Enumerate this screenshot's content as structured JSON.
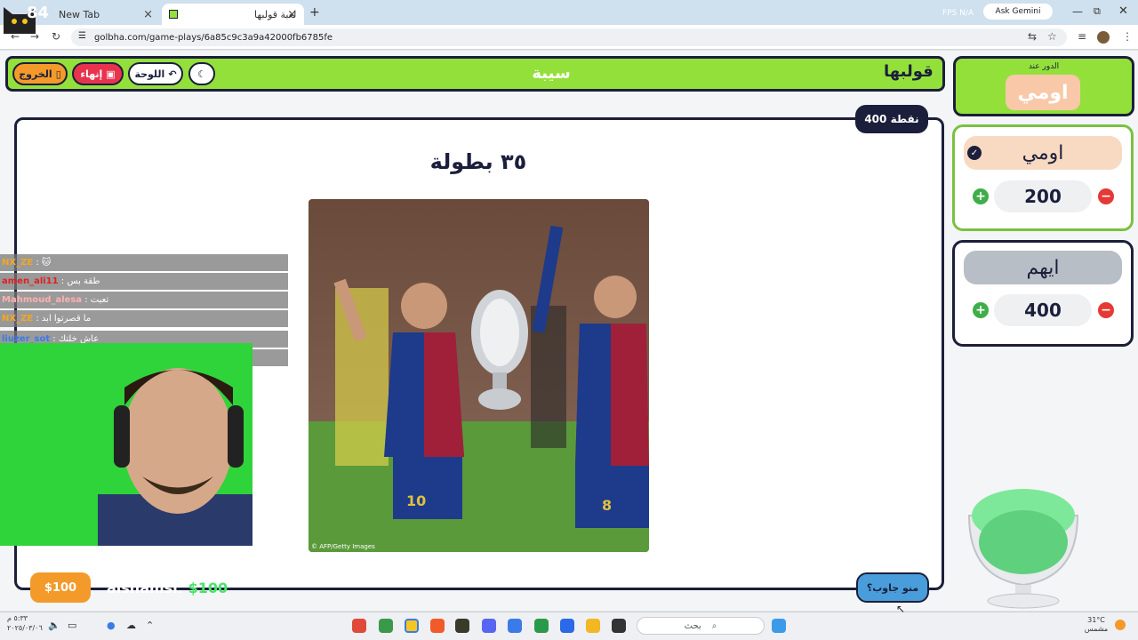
{
  "browser": {
    "tabs": [
      {
        "label": "New Tab"
      },
      {
        "label": "لعبة قولبها"
      }
    ],
    "url": "golbha.com/game-plays/6a85c9c3a9a42000fb6785fe",
    "ask_gemini": "Ask Gemini",
    "fps_readout": "FPS N/A"
  },
  "game": {
    "logo": "قولبها",
    "category": "سيبة",
    "buttons": {
      "exit": "الخروج",
      "end": "إنهاء",
      "board": "اللوحة"
    },
    "points_badge": "400 نقطة",
    "question": "٣٥ بطولة",
    "photo_credit": "© AFP/Getty Images",
    "who_answered": "منو جاوب؟"
  },
  "sidebar": {
    "turn_label": "الدور عند",
    "turn_team": "اومي",
    "teams": [
      {
        "name": "اومي",
        "score": "200"
      },
      {
        "name": "ايهم",
        "score": "400"
      }
    ]
  },
  "stream": {
    "viewer_count": "84",
    "chat": [
      {
        "user": "NX_ZE",
        "message": "🐱"
      },
      {
        "user": "amen_ali11",
        "message": "طقة بس"
      },
      {
        "user": "Mahmoud_alesa",
        "message": "تعبت"
      },
      {
        "user": "NX_ZE",
        "message": "ما قصرتوا ابد"
      },
      {
        "user": "liuzer_sot",
        "message": "عاش خلتك"
      }
    ],
    "donor_name": "alshamsi:",
    "donor_amount": "$100",
    "donor_pill": "$100"
  },
  "taskbar": {
    "search_placeholder": "بحث",
    "time": "٥:٣٣ م",
    "date": "٢٠٢٥/٠٣/٠٦",
    "temperature": "31°C",
    "weather": "مشمس"
  },
  "colors": {
    "header_green": "#94e03a",
    "navy": "#1b1f3b",
    "orange": "#f39a2a",
    "red": "#e8334e"
  }
}
